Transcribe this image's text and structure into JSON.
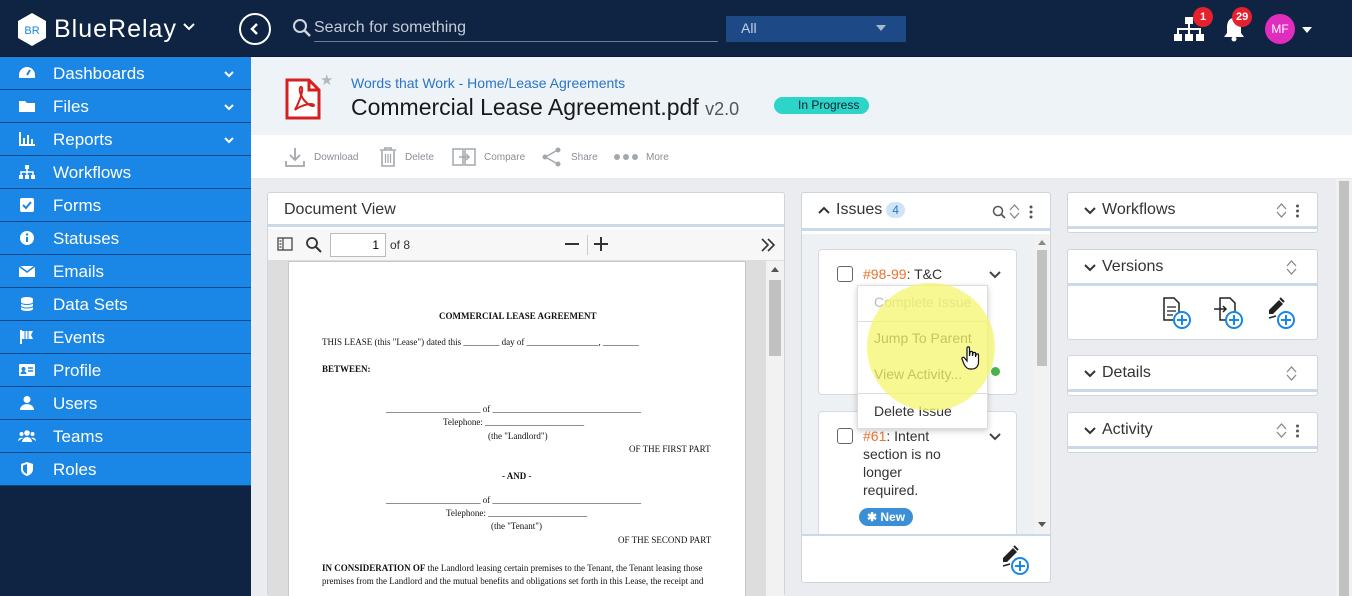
{
  "app": {
    "brand": "BlueRelay",
    "logo_text": "BR"
  },
  "topbar": {
    "search_placeholder": "Search for something",
    "scope": "All",
    "org_badge": "1",
    "notif_badge": "29",
    "avatar_initials": "MF"
  },
  "sidebar": {
    "items": [
      {
        "label": "Dashboards",
        "icon": "dashboard-icon",
        "expandable": true
      },
      {
        "label": "Files",
        "icon": "folder-icon",
        "expandable": true
      },
      {
        "label": "Reports",
        "icon": "bar-chart-icon",
        "expandable": true
      },
      {
        "label": "Workflows",
        "icon": "sitemap-icon",
        "expandable": false
      },
      {
        "label": "Forms",
        "icon": "checkbox-icon",
        "expandable": false
      },
      {
        "label": "Statuses",
        "icon": "info-icon",
        "expandable": false
      },
      {
        "label": "Emails",
        "icon": "envelope-icon",
        "expandable": false
      },
      {
        "label": "Data Sets",
        "icon": "database-icon",
        "expandable": false
      },
      {
        "label": "Events",
        "icon": "flag-icon",
        "expandable": false
      },
      {
        "label": "Profile",
        "icon": "id-card-icon",
        "expandable": false
      },
      {
        "label": "Users",
        "icon": "user-icon",
        "expandable": false
      },
      {
        "label": "Teams",
        "icon": "users-icon",
        "expandable": false
      },
      {
        "label": "Roles",
        "icon": "shield-icon",
        "expandable": false
      }
    ]
  },
  "document": {
    "breadcrumb": "Words that Work - Home/Lease Agreements",
    "title": "Commercial Lease Agreement.pdf",
    "version": "v2.0",
    "status": "In Progress"
  },
  "toolbar": {
    "download": "Download",
    "delete": "Delete",
    "compare": "Compare",
    "share": "Share",
    "more": "More"
  },
  "doc_view": {
    "title": "Document View",
    "page": "1",
    "of_pages": "of 8",
    "pdf_lines": {
      "heading": "COMMERCIAL LEASE AGREEMENT",
      "l1": "THIS LEASE (this \"Lease\") dated this ________ day of ________________, ________",
      "l2": "BETWEEN:",
      "l3": "_____________________ of _________________________________",
      "l4": "Telephone: ______________________",
      "l5": "(the \"Landlord\")",
      "l6": "OF THE FIRST PART",
      "l7": "- AND -",
      "l8": "_____________________ of _________________________________",
      "l9": "Telephone: ______________________",
      "l10": "(the \"Tenant\")",
      "l11": "OF THE SECOND PART",
      "l12a": "IN CONSIDERATION OF",
      "l12b": " the Landlord leasing certain premises to the Tenant, the Tenant leasing those",
      "l13": "premises from the Landlord and the mutual benefits and obligations set forth in this Lease, the receipt and"
    }
  },
  "issues": {
    "title": "Issues",
    "count": "4",
    "items": [
      {
        "number": "#98-99",
        "text": ": T&C"
      },
      {
        "number": "#61",
        "text_lines": [
          ": Intent",
          "section is no",
          "longer",
          "required."
        ],
        "badge": "New"
      }
    ],
    "context_menu": [
      "Complete Issue",
      "Jump To Parent",
      "View Activity...",
      "Delete Issue"
    ]
  },
  "widgets": {
    "workflows": "Workflows",
    "versions": "Versions",
    "details": "Details",
    "activity": "Activity"
  },
  "colors": {
    "topbar": "#0f2342",
    "nav": "#1a86e5",
    "status": "#2dd4c8",
    "issue_number": "#e8742c",
    "badge": "#e5212e"
  }
}
